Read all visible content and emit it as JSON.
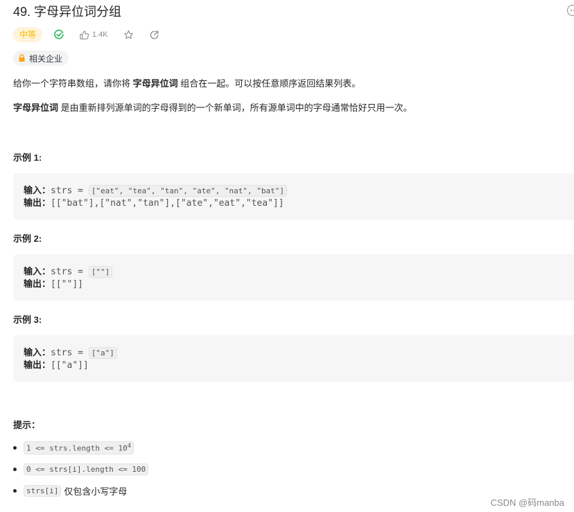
{
  "header": {
    "title": "49. 字母异位词分组",
    "difficulty": "中等",
    "likes": "1.4K",
    "company_tag": "相关企业",
    "colors": {
      "difficulty_text": "#ffb800",
      "difficulty_bg": "#fff3d9",
      "solved_check": "#2db55d",
      "lock": "#ffa116"
    },
    "icons": [
      "check-circle-icon",
      "thumbs-up-icon",
      "star-icon",
      "share-icon",
      "lock-icon",
      "more-icon"
    ]
  },
  "description": {
    "p1_before": "给你一个字符串数组，请你将 ",
    "p1_bold": "字母异位词",
    "p1_after": " 组合在一起。可以按任意顺序返回结果列表。",
    "p2_bold": "字母异位词",
    "p2_after": " 是由重新排列源单词的字母得到的一个新单词，所有源单词中的字母通常恰好只用一次。"
  },
  "examples": [
    {
      "heading": "示例 1:",
      "input_label": "输入：",
      "input_prefix": "strs = ",
      "input_value": "[\"eat\", \"tea\", \"tan\", \"ate\", \"nat\", \"bat\"]",
      "output_label": "输出：",
      "output_value": "[[\"bat\"],[\"nat\",\"tan\"],[\"ate\",\"eat\",\"tea\"]]"
    },
    {
      "heading": "示例 2:",
      "input_label": "输入：",
      "input_prefix": "strs = ",
      "input_value": "[\"\"]",
      "output_label": "输出：",
      "output_value": "[[\"\"]]"
    },
    {
      "heading": "示例 3:",
      "input_label": "输入：",
      "input_prefix": "strs = ",
      "input_value": "[\"a\"]",
      "output_label": "输出：",
      "output_value": "[[\"a\"]]"
    }
  ],
  "tips": {
    "heading": "提示：",
    "items": [
      {
        "code": "1 <= strs.length <= 10",
        "sup": "4",
        "text": ""
      },
      {
        "code": "0 <= strs[i].length <= 100",
        "sup": "",
        "text": ""
      },
      {
        "code": "strs[i]",
        "sup": "",
        "text": "仅包含小写字母"
      }
    ]
  },
  "watermark": "CSDN @码manba"
}
